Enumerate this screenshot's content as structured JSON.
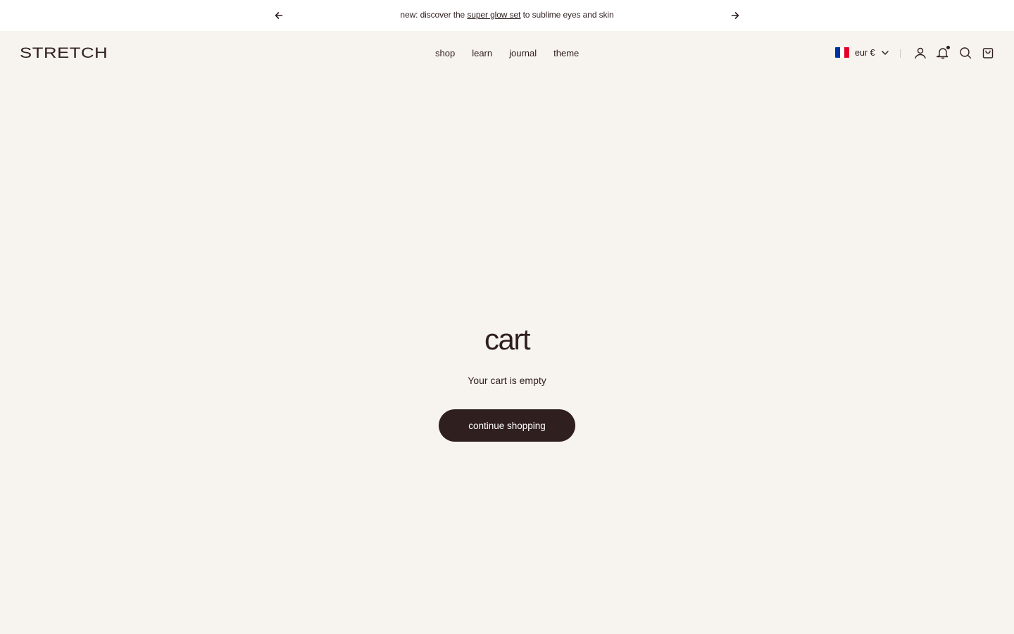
{
  "announcement": {
    "prefix": "new: discover the",
    "link": "super glow set",
    "suffix": "to sublime eyes and skin"
  },
  "header": {
    "logo": "STRETCH",
    "nav": [
      "shop",
      "learn",
      "journal",
      "theme"
    ],
    "currency": "eur €",
    "flag_colors": [
      "#0033a0",
      "#ffffff",
      "#e4002b"
    ]
  },
  "cart": {
    "title": "cart",
    "empty_message": "Your cart is empty",
    "button": "continue shopping"
  },
  "colors": {
    "background": "#f7f3ef",
    "text": "#2f1f1f",
    "button": "#2f1f1f"
  }
}
